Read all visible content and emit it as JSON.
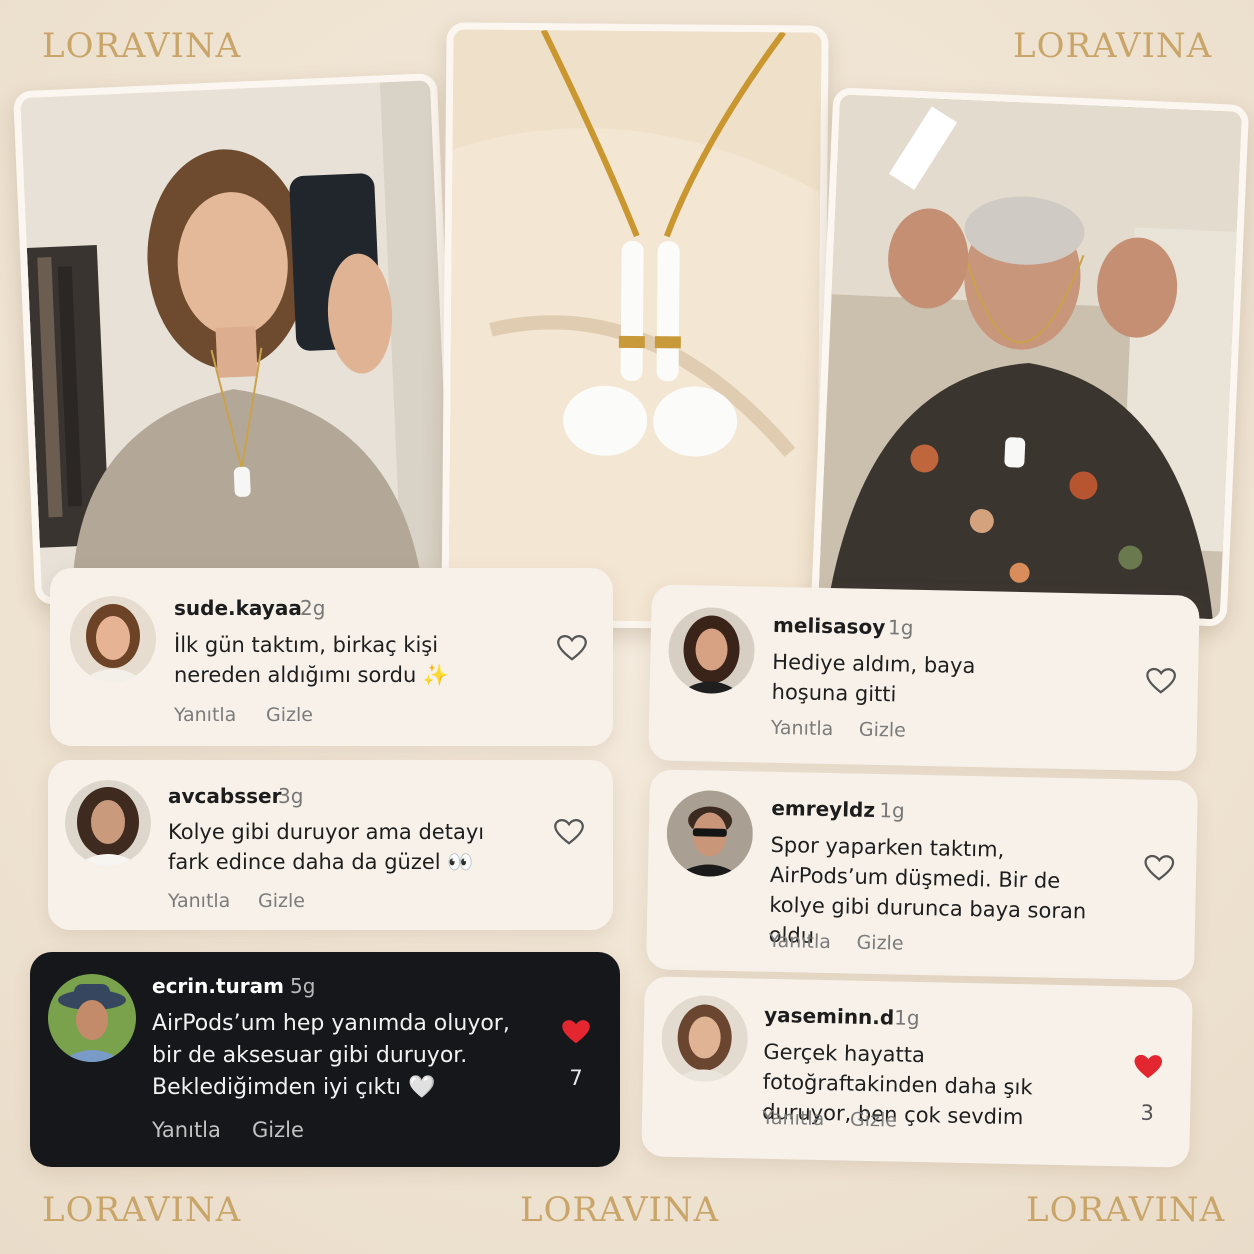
{
  "brand": {
    "watermarks": [
      "LORAVINA",
      "LORAVINA",
      "LORAVINA",
      "LORAVINA",
      "LORAVINA"
    ],
    "accent_color": "#c9a56a"
  },
  "comments": [
    {
      "username": "sude.kayaa",
      "time": "2g",
      "text": "İlk gün taktım, birkaç kişi nereden aldığımı sordu ✨",
      "reply_label": "Yanıtla",
      "hide_label": "Gizle",
      "liked": false
    },
    {
      "username": "avcabsser",
      "time": "3g",
      "text": "Kolye gibi duruyor ama detayı fark edince daha da güzel 👀",
      "reply_label": "Yanıtla",
      "hide_label": "Gizle",
      "liked": false
    },
    {
      "username": "ecrin.turam",
      "time": "5g",
      "text": "AirPods’um hep yanımda oluyor, bir de aksesuar gibi duruyor. Beklediğimden iyi çıktı 🤍",
      "reply_label": "Yanıtla",
      "hide_label": "Gizle",
      "liked": true,
      "likes": "7"
    },
    {
      "username": "melisasoy",
      "time": "1g",
      "text": "Hediye aldım, baya hoşuna gitti",
      "reply_label": "Yanıtla",
      "hide_label": "Gizle",
      "liked": false
    },
    {
      "username": "emreyldz",
      "time": "1g",
      "text": "Spor yaparken taktım, AirPods’um düşmedi. Bir de kolye gibi durunca baya soran oldu",
      "reply_label": "Yanıtla",
      "hide_label": "Gizle",
      "liked": false
    },
    {
      "username": "yaseminn.d",
      "time": "1g",
      "text": "Gerçek hayatta fotoğraftakinden daha şık duruyor, ben çok sevdim",
      "reply_label": "Yanıtla",
      "hide_label": "Gizle",
      "liked": true,
      "likes": "3"
    }
  ]
}
